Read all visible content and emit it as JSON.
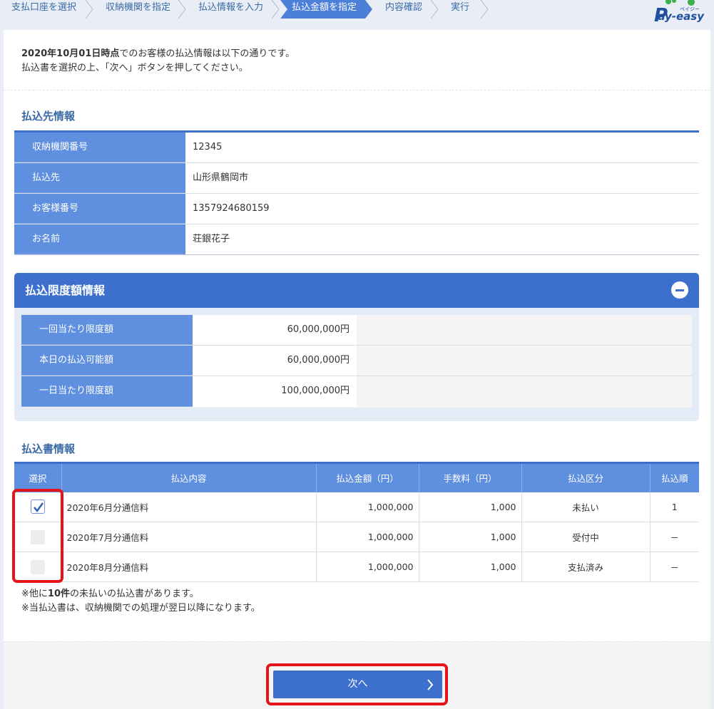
{
  "steps": [
    {
      "label": "支払口座を選択",
      "active": false
    },
    {
      "label": "収納機関を指定",
      "active": false
    },
    {
      "label": "払込情報を入力",
      "active": false
    },
    {
      "label": "払込金額を指定",
      "active": true
    },
    {
      "label": "内容確認",
      "active": false
    },
    {
      "label": "実行",
      "active": false
    }
  ],
  "logo": {
    "text": "ay-easy",
    "kana": "ペイジー",
    "initial": "P"
  },
  "intro": {
    "date": "2020年10月01日時点",
    "line1_rest": "でのお客様の払込情報は以下の通りです。",
    "line2": "払込書を選択の上、「次へ」ボタンを押してください。"
  },
  "payee": {
    "title": "払込先情報",
    "rows": [
      {
        "label": "収納機関番号",
        "value": "12345"
      },
      {
        "label": "払込先",
        "value": "山形県鶴岡市"
      },
      {
        "label": "お客様番号",
        "value": "1357924680159"
      },
      {
        "label": "お名前",
        "value": "荘銀花子"
      }
    ]
  },
  "limit": {
    "title": "払込限度額情報",
    "rows": [
      {
        "label": "一回当たり限度額",
        "value": "60,000,000円"
      },
      {
        "label": "本日の払込可能額",
        "value": "60,000,000円"
      },
      {
        "label": "一日当たり限度額",
        "value": "100,000,000円"
      }
    ]
  },
  "bills": {
    "title": "払込書情報",
    "headers": [
      "選択",
      "払込内容",
      "払込金額（円）",
      "手数料（円）",
      "払込区分",
      "払込順"
    ],
    "rows": [
      {
        "checked": true,
        "content": "2020年6月分通信料",
        "amount": "1,000,000",
        "fee": "1,000",
        "status": "未払い",
        "order": "1"
      },
      {
        "checked": false,
        "content": "2020年7月分通信料",
        "amount": "1,000,000",
        "fee": "1,000",
        "status": "受付中",
        "order": "－"
      },
      {
        "checked": false,
        "content": "2020年8月分通信料",
        "amount": "1,000,000",
        "fee": "1,000",
        "status": "支払済み",
        "order": "－"
      }
    ]
  },
  "notes": {
    "line1_pre": "※他に",
    "line1_bold": "10件",
    "line1_post": "の未払いの払込書があります。",
    "line2": "※当払込書は、収納機関での処理が翌日以降になります。"
  },
  "next_button": {
    "label": "次へ"
  },
  "colors": {
    "primary": "#3d6fcd",
    "label_bg": "#5f8fdf",
    "highlight": "#e3151a",
    "title": "#3a6aa5"
  }
}
